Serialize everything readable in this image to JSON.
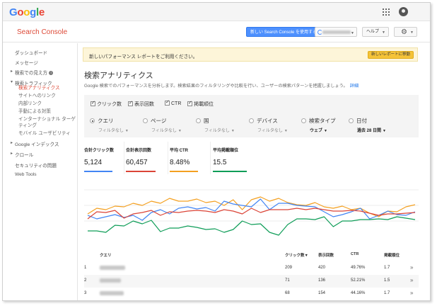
{
  "brand": {
    "logo_letters": [
      {
        "ch": "G",
        "color": "#4285F4"
      },
      {
        "ch": "o",
        "color": "#EA4335"
      },
      {
        "ch": "o",
        "color": "#FBBC05"
      },
      {
        "ch": "g",
        "color": "#4285F4"
      },
      {
        "ch": "l",
        "color": "#34A853"
      },
      {
        "ch": "e",
        "color": "#EA4335"
      }
    ]
  },
  "header": {
    "product_title": "Search Console",
    "new_console_button": "新しい Search Console を使用する",
    "help_button": "ヘルプ",
    "icons": [
      "apps-grid-icon",
      "account-icon",
      "gear-icon"
    ]
  },
  "sidebar": {
    "dashboard": "ダッシュボード",
    "messages": "メッセージ",
    "search_appearance": "検索での見え方",
    "search_traffic": "検索トラフィック",
    "search_traffic_items": [
      "検索アナリティクス",
      "サイトへのリンク",
      "内部リンク",
      "手動による対策",
      "インターナショナル ターゲ",
      "ティング",
      "モバイル ユーザビリティ"
    ],
    "google_index": "Google インデックス",
    "crawl": "クロール",
    "security": "セキュリティの問題",
    "web_tools": "Web Tools"
  },
  "banner": {
    "text": "新しいパフォーマンス レポートをご利用ください。",
    "button": "新しいレポートに移動"
  },
  "page": {
    "title": "検索アナリティクス",
    "description": "Google 検索でのパフォーマンスを分析します。検索結果のフィルタリングや比較を行い、ユーザーの検索パターンを把握しましょう。",
    "details_link": "詳細"
  },
  "metric_toggles": [
    "クリック数",
    "表示回数",
    "CTR",
    "掲載順位"
  ],
  "dimensions": [
    {
      "label": "クエリ",
      "selected": true,
      "sub": "フィルタなし"
    },
    {
      "label": "ページ",
      "selected": false,
      "sub": "フィルタなし"
    },
    {
      "label": "国",
      "selected": false,
      "sub": "フィルタなし"
    },
    {
      "label": "デバイス",
      "selected": false,
      "sub": "フィルタなし"
    },
    {
      "label": "検索タイプ",
      "selected": false,
      "sub": "ウェブ"
    },
    {
      "label": "日付",
      "selected": false,
      "sub": "過去 28 日間"
    }
  ],
  "metrics": [
    {
      "label": "合計クリック数",
      "value": "5,124",
      "color": "#4285F4"
    },
    {
      "label": "合計表示回数",
      "value": "60,457",
      "color": "#DB4437"
    },
    {
      "label": "平均 CTR",
      "value": "8.48%",
      "color": "#F4A020"
    },
    {
      "label": "平均掲載順位",
      "value": "15.5",
      "color": "#0F9D58"
    }
  ],
  "chart_data": {
    "type": "line",
    "series": [
      {
        "color": "#F4A020",
        "values": [
          48,
          40,
          42,
          37,
          38,
          33,
          36,
          30,
          33,
          26,
          30,
          30,
          27,
          32,
          30,
          36,
          28,
          42,
          28,
          24,
          30,
          26,
          32,
          35,
          36,
          32,
          38,
          40,
          37,
          42,
          40,
          47,
          52,
          44,
          45,
          38,
          35
        ]
      },
      {
        "color": "#4285F4",
        "values": [
          50,
          55,
          52,
          49,
          53,
          50,
          57,
          46,
          42,
          48,
          40,
          38,
          41,
          39,
          44,
          30,
          34,
          36,
          38,
          27,
          42,
          33,
          33,
          36,
          37,
          38,
          45,
          52,
          49,
          45,
          40,
          55,
          50,
          44,
          49,
          50,
          45
        ]
      },
      {
        "color": "#DB4437",
        "values": [
          55,
          45,
          46,
          43,
          54,
          48,
          46,
          43,
          50,
          45,
          46,
          44,
          43,
          44,
          46,
          42,
          44,
          48,
          40,
          46,
          42,
          42,
          42,
          40,
          42,
          40,
          42,
          44,
          44,
          43,
          44,
          47,
          50,
          48,
          48,
          47,
          46
        ]
      },
      {
        "color": "#0F9D58",
        "values": [
          72,
          72,
          74,
          64,
          65,
          58,
          62,
          57,
          73,
          68,
          68,
          65,
          67,
          70,
          69,
          74,
          70,
          58,
          63,
          62,
          74,
          78,
          63,
          55,
          55,
          56,
          52,
          66,
          58,
          58,
          56,
          56,
          55,
          56,
          52,
          54,
          56
        ]
      }
    ]
  },
  "table": {
    "headers": {
      "query": "クエリ",
      "clicks": "クリック数▼",
      "impressions": "表示回数",
      "ctr": "CTR",
      "position": "掲載順位"
    },
    "rows": [
      {
        "n": "1",
        "clicks": "209",
        "impressions": "420",
        "ctr": "49.76%",
        "position": "1.7"
      },
      {
        "n": "2",
        "clicks": "71",
        "impressions": "136",
        "ctr": "52.21%",
        "position": "1.5"
      },
      {
        "n": "3",
        "clicks": "68",
        "impressions": "154",
        "ctr": "44.16%",
        "position": "1.7"
      }
    ],
    "row_action": "»"
  }
}
